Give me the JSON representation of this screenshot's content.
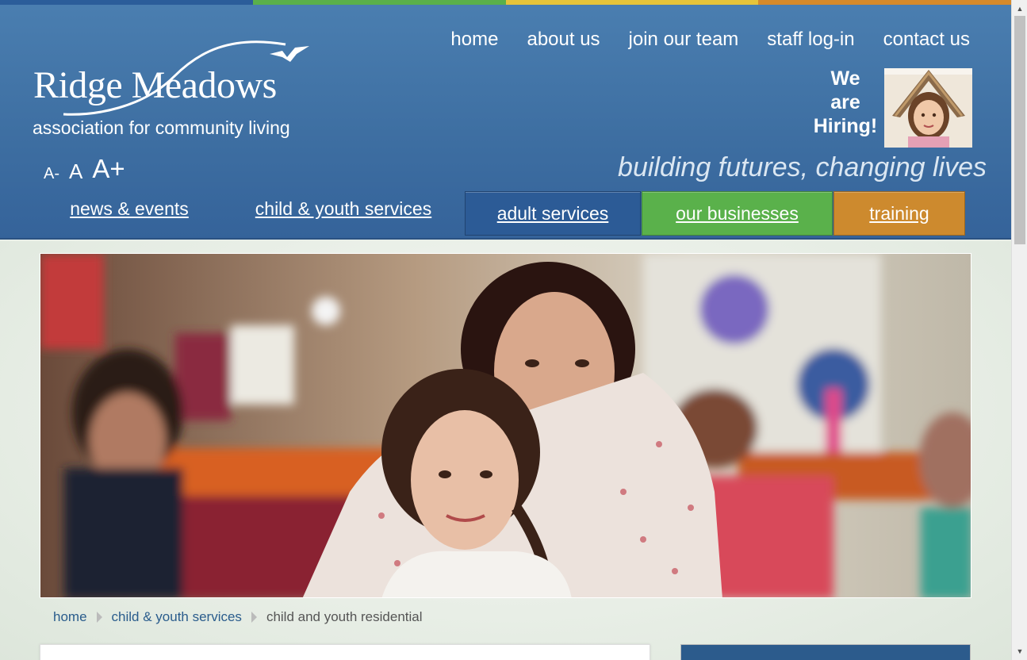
{
  "top_strip_colors": [
    "#2b5d9a",
    "#5ab04a",
    "#e6c43a",
    "#d68a2a"
  ],
  "logo": {
    "name": "Ridge Meadows",
    "tagline": "association for community living"
  },
  "top_nav": [
    {
      "label": "home"
    },
    {
      "label": "about us"
    },
    {
      "label": "join our team"
    },
    {
      "label": "staff log-in"
    },
    {
      "label": "contact us"
    }
  ],
  "hiring": {
    "line1": "We",
    "line2": "are",
    "line3": "Hiring!"
  },
  "font_controls": {
    "decrease": "A-",
    "normal": "A",
    "increase": "A+"
  },
  "slogan": "building futures, changing lives",
  "main_nav": [
    {
      "label": "news & events",
      "color": ""
    },
    {
      "label": "child & youth services",
      "color": ""
    },
    {
      "label": "adult services",
      "color": "#2c5b96"
    },
    {
      "label": "our businesses",
      "color": "#5ab14b"
    },
    {
      "label": "training",
      "color": "#cd8a2e"
    }
  ],
  "breadcrumb": {
    "home": "home",
    "section": "child & youth services",
    "current": "child and youth residential"
  }
}
